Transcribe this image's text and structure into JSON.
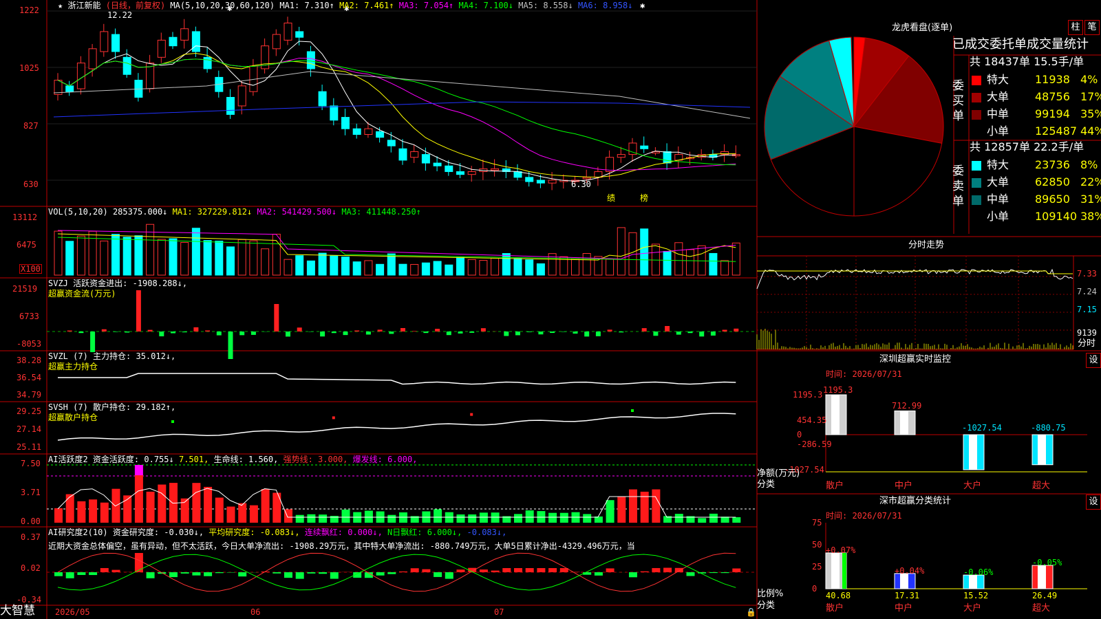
{
  "stock": {
    "star": "★",
    "name": "浙江新能",
    "mode": "(日线，前复权)",
    "ma_label": "MA(5,10,20,30,60,120)",
    "ma1": "MA1: 7.310↑",
    "ma2": "MA2: 7.461↑",
    "ma3": "MA3: 7.054↑",
    "ma4": "MA4: 7.100↓",
    "ma5": "MA5: 8.558↓",
    "ma6": "MA6: 8.958↓",
    "high_mark": "12.22",
    "low_mark": "6.30",
    "event1": "绩",
    "event2": "榜"
  },
  "price_axis": [
    "1222",
    "1025",
    "827",
    "630"
  ],
  "vol": {
    "label": "VOL(5,10,20)",
    "v": "285375.000↓",
    "ma1": "MA1: 327229.812↓",
    "ma2": "MA2: 541429.500↓",
    "ma3": "MA3: 411448.250↑",
    "axis": [
      "13112",
      "6475"
    ],
    "unit": "X100"
  },
  "svzj": {
    "name": "SVZJ",
    "desc": "活跃资金进出: -1908.288↓,",
    "sub": "超赢资金流(万元)",
    "axis": [
      "21519",
      "6733",
      "-8053"
    ]
  },
  "svzl": {
    "name": "SVZL (7)",
    "desc": "主力持仓: 35.012↓,",
    "sub": "超赢主力持仓",
    "axis": [
      "38.28",
      "36.54",
      "34.79"
    ]
  },
  "svsh": {
    "name": "SVSH (7)",
    "desc": "散户持仓: 29.182↑,",
    "sub": "超赢散户持仓",
    "axis": [
      "29.25",
      "27.14",
      "25.11"
    ]
  },
  "ai1": {
    "name": "AI活跃度2",
    "a": "资金活跃度: 0.755↓",
    "b": "7.501,",
    "c": "生命线: 1.560,",
    "d": "强势线: 3.000,",
    "e": "爆发线: 6.000,",
    "axis": [
      "7.50",
      "3.71",
      "0.00"
    ]
  },
  "ai2": {
    "name": "AI研究度2(10)",
    "a": "资金研究度: -0.030↓,",
    "b": "平均研究度: -0.083↓,",
    "c": "连续飘红: 0.000↓,",
    "d": "N日飘红: 6.000↓,",
    "e": "-0.083↓,",
    "text": "近期大资金总体偏空，虽有异动，但不太活跃，今日大单净流出: -1908.29万元，其中特大单净流出: -880.749万元，大单5日累计净出-4329.496万元，当",
    "axis": [
      "0.37",
      "0.02",
      "-0.34"
    ]
  },
  "dates": [
    "2026/05",
    "06",
    "07"
  ],
  "brand": "大智慧",
  "lhb": {
    "title": "龙虎看盘(逐单)",
    "btn1": "柱",
    "btn2": "笔",
    "subtitle": "已成交委托单成交量统计",
    "buy_label": "委买单",
    "sell_label": "委卖单",
    "buy_total": "共 18437单 15.5手/单",
    "sell_total": "共 12857单 22.2手/单",
    "buy_rows": [
      {
        "name": "特大",
        "val": "11938",
        "pct": "4%",
        "color": "#ff0000"
      },
      {
        "name": "大单",
        "val": "48756",
        "pct": "17%",
        "color": "#a00000"
      },
      {
        "name": "中单",
        "val": "99194",
        "pct": "35%",
        "color": "#800000"
      },
      {
        "name": "小单",
        "val": "125487",
        "pct": "44%",
        "color": "#000000"
      }
    ],
    "sell_rows": [
      {
        "name": "特大",
        "val": "23736",
        "pct": "8%",
        "color": "#00ffff"
      },
      {
        "name": "大单",
        "val": "62850",
        "pct": "22%",
        "color": "#008080"
      },
      {
        "name": "中单",
        "val": "89650",
        "pct": "31%",
        "color": "#006a6a"
      },
      {
        "name": "小单",
        "val": "109140",
        "pct": "38%",
        "color": "#000000"
      }
    ]
  },
  "fenshi": {
    "title": "分时走势",
    "axis": [
      "7.33",
      "7.24",
      "7.15"
    ],
    "vol": "9139",
    "fen": "分时"
  },
  "sz_monitor": {
    "title": "深圳超赢实时监控",
    "btn": "设",
    "time": "时间: 2026/07/31",
    "axis": [
      "1195.3",
      "454.35",
      "0",
      "-286.59",
      "-1027.54"
    ],
    "bars": [
      {
        "name": "散户",
        "val": "1195.3"
      },
      {
        "name": "中户",
        "val": "712.99"
      },
      {
        "name": "大户",
        "val": "-1027.54"
      },
      {
        "name": "超大",
        "val": "-880.75"
      }
    ],
    "ylabel": "净额(万元)",
    "xlabel": "分类"
  },
  "sz_stat": {
    "title": "深市超赢分类统计",
    "btn": "设",
    "time": "时间: 2026/07/31",
    "axis": [
      "75",
      "50",
      "25",
      "0"
    ],
    "bars": [
      {
        "name": "散户",
        "top": "+0.07%",
        "bottom": "40.68"
      },
      {
        "name": "中户",
        "top": "+0.04%",
        "bottom": "17.31"
      },
      {
        "name": "大户",
        "top": "-0.06%",
        "bottom": "15.52"
      },
      {
        "name": "超大",
        "top": "-0.05%",
        "bottom": "26.49"
      }
    ],
    "ylabel": "比例%",
    "xlabel": "分类"
  }
}
